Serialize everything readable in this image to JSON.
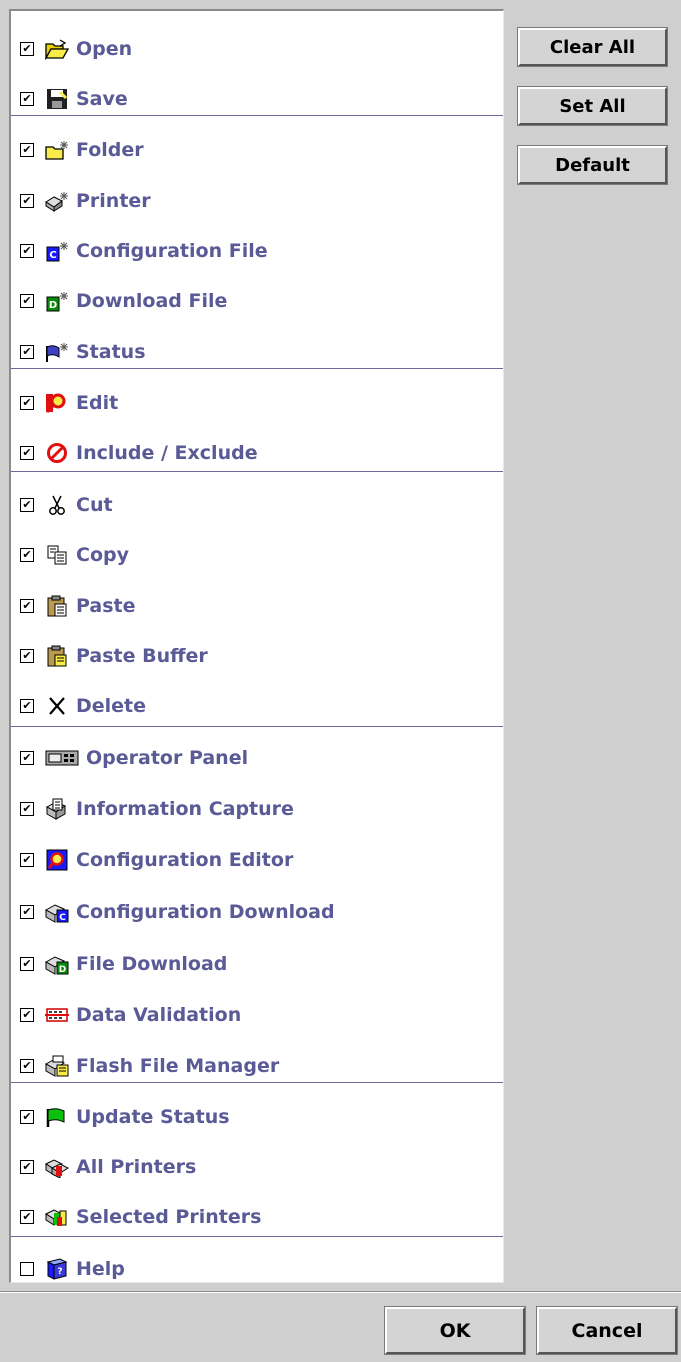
{
  "buttons": {
    "clear_all": "Clear All",
    "set_all": "Set All",
    "default": "Default",
    "ok": "OK",
    "cancel": "Cancel"
  },
  "items": [
    {
      "label": "Open",
      "checked": true,
      "icon": "open-folder-icon"
    },
    {
      "label": "Save",
      "checked": true,
      "icon": "save-disk-icon"
    },
    {
      "label": "Folder",
      "checked": true,
      "icon": "new-folder-icon"
    },
    {
      "label": "Printer",
      "checked": true,
      "icon": "new-printer-icon"
    },
    {
      "label": "Configuration File",
      "checked": true,
      "icon": "new-config-file-icon"
    },
    {
      "label": "Download File",
      "checked": true,
      "icon": "new-download-file-icon"
    },
    {
      "label": "Status",
      "checked": true,
      "icon": "new-status-flag-icon"
    },
    {
      "label": "Edit",
      "checked": true,
      "icon": "edit-magnifier-icon"
    },
    {
      "label": "Include / Exclude",
      "checked": true,
      "icon": "prohibited-icon"
    },
    {
      "label": "Cut",
      "checked": true,
      "icon": "scissors-icon"
    },
    {
      "label": "Copy",
      "checked": true,
      "icon": "copy-icon"
    },
    {
      "label": "Paste",
      "checked": true,
      "icon": "paste-clipboard-icon"
    },
    {
      "label": "Paste Buffer",
      "checked": true,
      "icon": "paste-buffer-icon"
    },
    {
      "label": "Delete",
      "checked": true,
      "icon": "delete-x-icon"
    },
    {
      "label": "Operator Panel",
      "checked": true,
      "icon": "operator-panel-icon"
    },
    {
      "label": "Information Capture",
      "checked": true,
      "icon": "information-capture-icon"
    },
    {
      "label": "Configuration Editor",
      "checked": true,
      "icon": "configuration-editor-icon"
    },
    {
      "label": "Configuration Download",
      "checked": true,
      "icon": "configuration-download-icon"
    },
    {
      "label": "File Download",
      "checked": true,
      "icon": "file-download-icon"
    },
    {
      "label": "Data Validation",
      "checked": true,
      "icon": "data-validation-icon"
    },
    {
      "label": "Flash File Manager",
      "checked": true,
      "icon": "flash-file-manager-icon"
    },
    {
      "label": "Update Status",
      "checked": true,
      "icon": "update-status-flag-icon"
    },
    {
      "label": "All Printers",
      "checked": true,
      "icon": "all-printers-icon"
    },
    {
      "label": "Selected Printers",
      "checked": true,
      "icon": "selected-printers-icon"
    },
    {
      "label": "Help",
      "checked": false,
      "icon": "help-book-icon"
    }
  ]
}
